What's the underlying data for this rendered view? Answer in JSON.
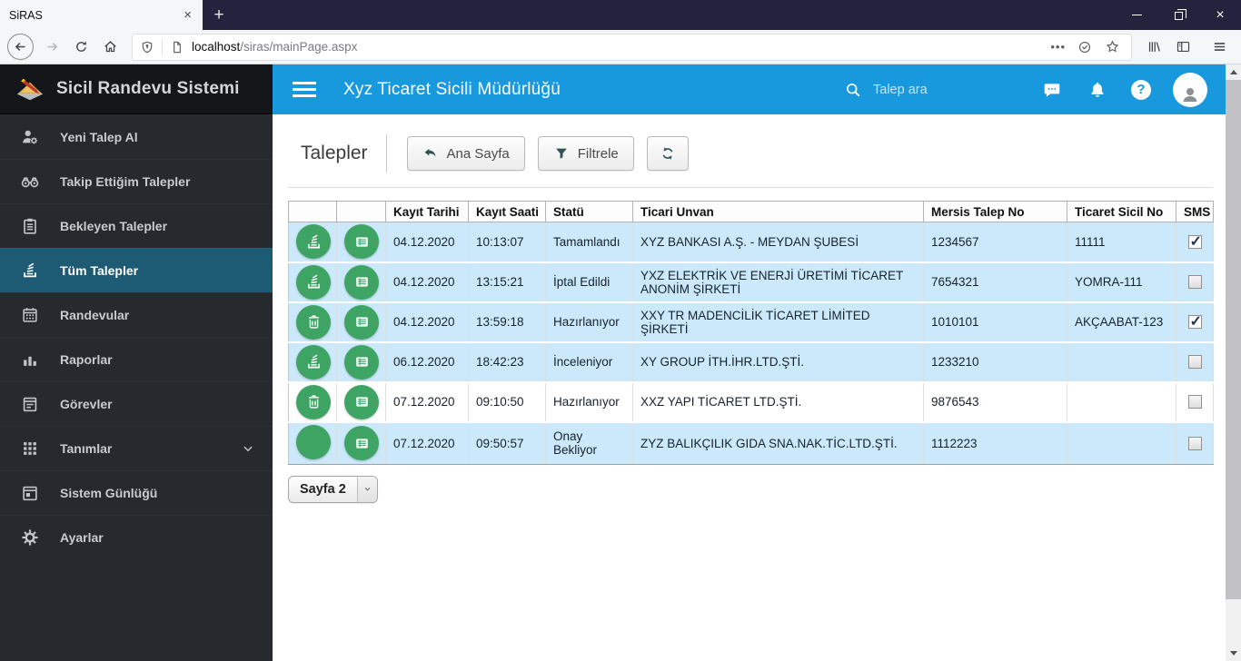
{
  "browser": {
    "tab_title": "SiRAS",
    "url_host": "localhost",
    "url_path": "/siras/mainPage.aspx"
  },
  "icons": {
    "close": "×",
    "new_tab": "+",
    "overflow_dots": "•••",
    "help": "?"
  },
  "brand": {
    "title": "Sicil Randevu Sistemi"
  },
  "header": {
    "title": "Xyz Ticaret Sicili Müdürlüğü",
    "search_placeholder": "Talep ara"
  },
  "sidebar": {
    "items": [
      {
        "id": "yeni-talep-al",
        "label": "Yeni Talep Al",
        "icon": "person-gear"
      },
      {
        "id": "takip-ettigim-talepler",
        "label": "Takip Ettiğim Talepler",
        "icon": "binoculars"
      },
      {
        "id": "bekleyen-talepler",
        "label": "Bekleyen Talepler",
        "icon": "clipboard"
      },
      {
        "id": "tum-talepler",
        "label": "Tüm Talepler",
        "icon": "stack",
        "active": true
      },
      {
        "id": "randevular",
        "label": "Randevular",
        "icon": "calendar-grid"
      },
      {
        "id": "raporlar",
        "label": "Raporlar",
        "icon": "bar-chart"
      },
      {
        "id": "gorevler",
        "label": "Görevler",
        "icon": "calendar-lines"
      },
      {
        "id": "tanimlar",
        "label": "Tanımlar",
        "icon": "grid",
        "chevron": true
      },
      {
        "id": "sistem-gunlugu",
        "label": "Sistem Günlüğü",
        "icon": "calendar-box"
      },
      {
        "id": "ayarlar",
        "label": "Ayarlar",
        "icon": "gear"
      }
    ]
  },
  "toolbar": {
    "page_title": "Talepler",
    "home_label": "Ana Sayfa",
    "filter_label": "Filtrele"
  },
  "table": {
    "columns": [
      "",
      "",
      "Kayıt Tarihi",
      "Kayıt Saati",
      "Statü",
      "Ticari Unvan",
      "Mersis Talep No",
      "Ticaret Sicil No",
      "SMS"
    ],
    "rows": [
      {
        "action_icon": "stack",
        "date": "04.12.2020",
        "time": "10:13:07",
        "status": "Tamamlandı",
        "company": "XYZ BANKASI A.Ş. - MEYDAN ŞUBESİ",
        "mersis": "1234567",
        "sicil": "11111",
        "sms": true,
        "highlight": true
      },
      {
        "action_icon": "stack",
        "date": "04.12.2020",
        "time": "13:15:21",
        "status": "İptal Edildi",
        "company": "YXZ ELEKTRİK VE ENERJİ ÜRETİMİ TİCARET ANONİM ŞİRKETİ",
        "mersis": "7654321",
        "sicil": "YOMRA-111",
        "sms": false,
        "highlight": true
      },
      {
        "action_icon": "trash",
        "date": "04.12.2020",
        "time": "13:59:18",
        "status": "Hazırlanıyor",
        "company": "XXY TR MADENCİLİK TİCARET LİMİTED ŞİRKETİ",
        "mersis": "1010101",
        "sicil": "AKÇAABAT-123",
        "sms": true,
        "highlight": true
      },
      {
        "action_icon": "stack",
        "date": "06.12.2020",
        "time": "18:42:23",
        "status": "İnceleniyor",
        "company": "XY GROUP İTH.İHR.LTD.ŞTİ.",
        "mersis": "1233210",
        "sicil": "",
        "sms": false,
        "highlight": true
      },
      {
        "action_icon": "trash",
        "date": "07.12.2020",
        "time": "09:10:50",
        "status": "Hazırlanıyor",
        "company": "XXZ YAPI TİCARET LTD.ŞTİ.",
        "mersis": "9876543",
        "sicil": "",
        "sms": false,
        "highlight": false
      },
      {
        "action_icon": "",
        "date": "07.12.2020",
        "time": "09:50:57",
        "status": "Onay Bekliyor",
        "company": "ZYZ BALIKÇILIK GIDA SNA.NAK.TİC.LTD.ŞTİ.",
        "mersis": "1112223",
        "sicil": "",
        "sms": false,
        "highlight": true
      }
    ]
  },
  "pagination": {
    "page_label": "Sayfa 2"
  },
  "colors": {
    "header_blue": "#1899dd",
    "sidebar_bg": "#26292d",
    "sidebar_brand_bg": "#141619",
    "sidebar_active": "#1d5b74",
    "row_highlight": "#cbe9fa",
    "action_green": "#3da463",
    "icon_dark_teal": "#2f5259",
    "titlebar_dark": "#24223d"
  }
}
